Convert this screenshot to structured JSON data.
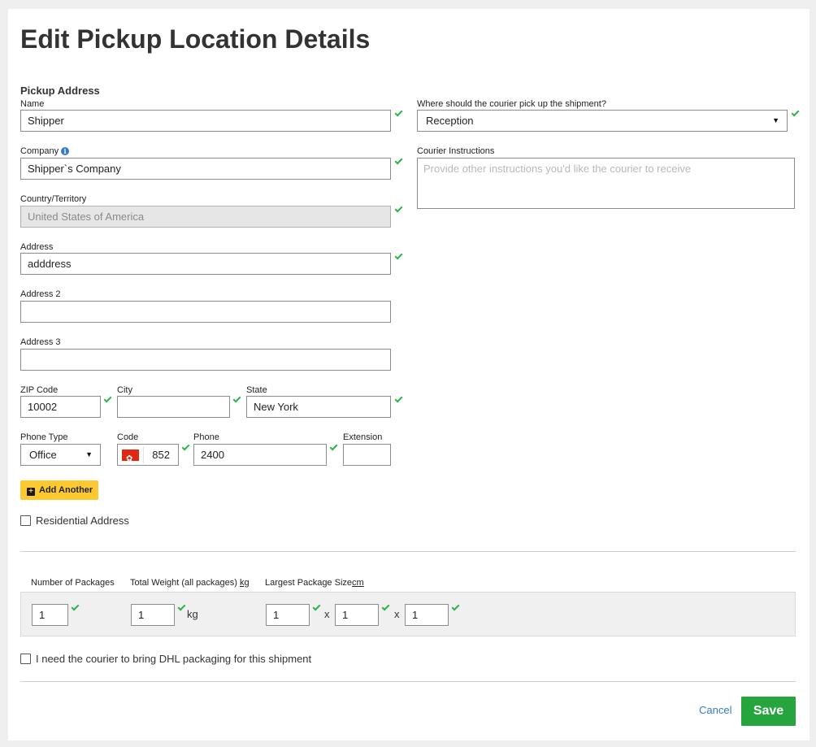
{
  "page": {
    "title": "Edit Pickup Location Details"
  },
  "pickup_address": {
    "section_title": "Pickup Address",
    "name": {
      "label": "Name",
      "value": "Shipper"
    },
    "company": {
      "label": "Company",
      "value": "Shipper`s Company"
    },
    "country": {
      "label": "Country/Territory",
      "value": "United States of America"
    },
    "address": {
      "label": "Address",
      "value": "adddress"
    },
    "address2": {
      "label": "Address 2",
      "value": ""
    },
    "address3": {
      "label": "Address 3",
      "value": ""
    },
    "zip": {
      "label": "ZIP Code",
      "value": "10002"
    },
    "city": {
      "label": "City",
      "value": ""
    },
    "state": {
      "label": "State",
      "value": "New York"
    },
    "phone_type": {
      "label": "Phone Type",
      "value": "Office"
    },
    "code": {
      "label": "Code",
      "value": "852"
    },
    "phone": {
      "label": "Phone",
      "value": "2400"
    },
    "extension": {
      "label": "Extension",
      "value": ""
    },
    "add_another": "Add Another",
    "residential": "Residential Address"
  },
  "pickup_options": {
    "where_label": "Where should the courier pick up the shipment?",
    "where_value": "Reception",
    "instructions_label": "Courier Instructions",
    "instructions_placeholder": "Provide other instructions you'd like the courier to receive"
  },
  "packages": {
    "count_label": "Number of Packages",
    "count_value": "1",
    "weight_label": "Total Weight (all packages)",
    "weight_unit_link": "kg",
    "weight_value": "1",
    "weight_unit": "kg",
    "size_label": "Largest Package Size",
    "size_unit_link": "cm",
    "length": "1",
    "width": "1",
    "height": "1",
    "times": "x"
  },
  "packaging_checkbox": "I need the courier to bring DHL packaging for this shipment",
  "actions": {
    "cancel": "Cancel",
    "save": "Save"
  },
  "colors": {
    "save": "#26a53e",
    "add_button": "#fdc932",
    "link": "#2f7dc8",
    "check": "#2db34a"
  }
}
